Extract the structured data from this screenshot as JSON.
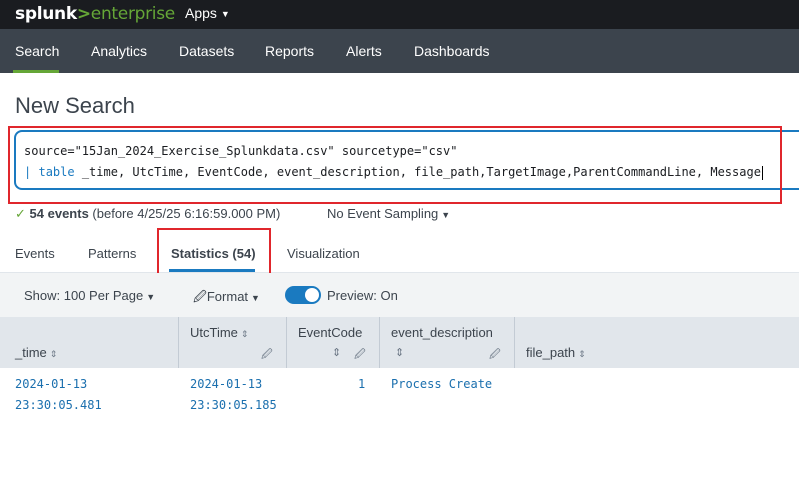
{
  "topbar": {
    "logo_splunk": "splunk",
    "logo_gt": ">",
    "logo_enterprise": "enterprise",
    "apps_label": "Apps"
  },
  "nav": {
    "items": [
      "Search",
      "Analytics",
      "Datasets",
      "Reports",
      "Alerts",
      "Dashboards"
    ],
    "active": "Search",
    "accent_color": "#65a637"
  },
  "page_title": "New Search",
  "search": {
    "line1": "source=\"15Jan_2024_Exercise_Splunkdata.csv\" sourcetype=\"csv\"",
    "line2_pipe": "|",
    "line2_cmd": "table",
    "line2_rest": " _time, UtcTime, EventCode, event_description, file_path,TargetImage,ParentCommandLine, Message"
  },
  "status": {
    "count": "54 events",
    "detail": "(before 4/25/25 6:16:59.000 PM)",
    "sampling": "No Event Sampling"
  },
  "tabs": {
    "items": [
      "Events",
      "Patterns",
      "Statistics (54)",
      "Visualization"
    ],
    "active": "Statistics (54)"
  },
  "toolbar": {
    "show_label": "Show: 100 Per Page",
    "format_label": "Format",
    "preview_label": "Preview: On",
    "preview_on": true
  },
  "table": {
    "columns": [
      "_time",
      "UtcTime",
      "EventCode",
      "event_description",
      "file_path"
    ],
    "rows": [
      {
        "_time": [
          "2024-01-13",
          "23:30:05.481"
        ],
        "UtcTime": [
          "2024-01-13",
          "23:30:05.185"
        ],
        "EventCode": "1",
        "event_description": "Process Create",
        "file_path": ""
      }
    ]
  },
  "icons": {
    "sort": "sort-icon",
    "edit": "pencil-icon",
    "check": "check-icon",
    "caret": "caret-down-icon"
  },
  "colors": {
    "highlight_red": "#e0262c",
    "search_blue": "#1a7ac0",
    "nav_bg": "#3c444d",
    "topbar_bg": "#1a1c20"
  }
}
